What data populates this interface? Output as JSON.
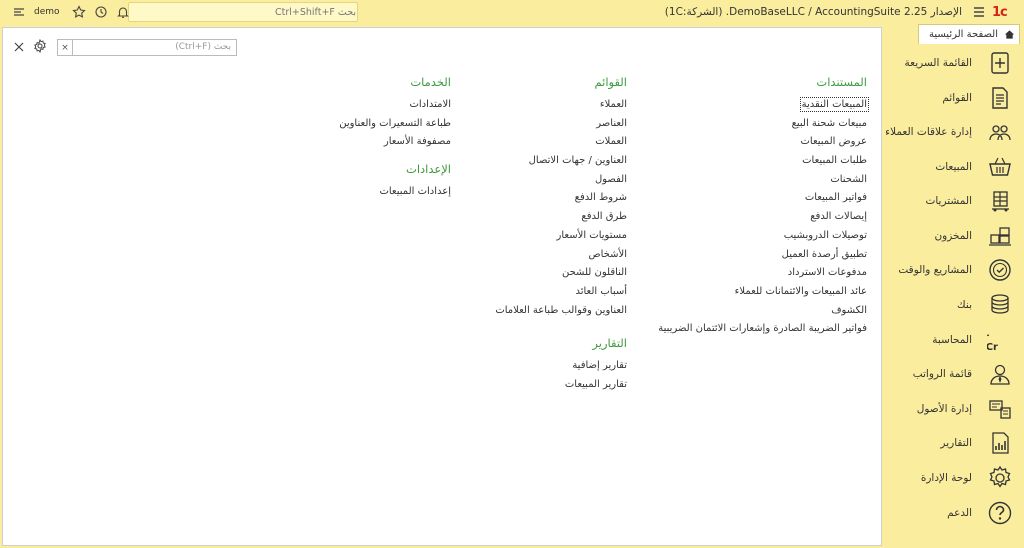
{
  "topbar": {
    "brand": "1c",
    "app_title": "الإصدار 2.25  DemoBaseLLC / AccountingSuite.  (الشركة:1C)",
    "search_placeholder": "بحث Ctrl+Shift+F",
    "user_name": "demo"
  },
  "sidebar": {
    "items": [
      {
        "label": "القائمة السريعة",
        "icon": "plus-box-icon"
      },
      {
        "label": "القوائم",
        "icon": "document-list-icon"
      },
      {
        "label": "إدارة علاقات العملاء",
        "icon": "people-icon"
      },
      {
        "label": "المبيعات",
        "icon": "basket-icon"
      },
      {
        "label": "المشتريات",
        "icon": "cart-icon"
      },
      {
        "label": "المخزون",
        "icon": "boxes-icon"
      },
      {
        "label": "المشاريع والوقت",
        "icon": "clock-check-icon"
      },
      {
        "label": "بنك",
        "icon": "coins-icon"
      },
      {
        "label": "المحاسبة",
        "icon": "dr-cr-icon"
      },
      {
        "label": "قائمة الرواتب",
        "icon": "employee-icon"
      },
      {
        "label": "إدارة الأصول",
        "icon": "assets-icon"
      },
      {
        "label": "التقارير",
        "icon": "report-icon"
      },
      {
        "label": "لوحة الإدارة",
        "icon": "gear-icon"
      },
      {
        "label": "الدعم",
        "icon": "help-icon"
      }
    ]
  },
  "home_tab": {
    "label": "الصفحة الرئيسية"
  },
  "section_search": {
    "placeholder": "بحث (Ctrl+F)",
    "clear": "×"
  },
  "documents": {
    "title": "المستندات",
    "items": [
      "المبيعات النقدية",
      "مبيعات شحنة البيع",
      "عروض المبيعات",
      "طلبات المبيعات",
      "الشحنات",
      "فواتير المبيعات",
      "إيصالات الدفع",
      "توصيلات الدروبشيب",
      "تطبيق أرصدة العميل",
      "مدفوعات الاسترداد",
      "عائد المبيعات والائتمانات للعملاء",
      "الكشوف",
      "فواتير الضريبة الصادرة وإشعارات الائتمان الضريبية"
    ]
  },
  "lists": {
    "title": "القوائم",
    "items": [
      "العملاء",
      "العناصر",
      "العملات",
      "العناوين / جهات الاتصال",
      "الفصول",
      "شروط الدفع",
      "طرق الدفع",
      "مستويات الأسعار",
      "الأشخاص",
      "الناقلون للشحن",
      "أسباب العائد",
      "العناوين وقوالب طباعة العلامات"
    ]
  },
  "reports": {
    "title": "التقارير",
    "items": [
      "تقارير إضافية",
      "تقارير المبيعات"
    ]
  },
  "services": {
    "title": "الخدمات",
    "items": [
      "الامتدادات",
      "طباعة التسعيرات والعناوين",
      "مصفوفة الأسعار"
    ]
  },
  "settings": {
    "title": "الإعدادات",
    "items": [
      "إعدادات المبيعات"
    ]
  }
}
